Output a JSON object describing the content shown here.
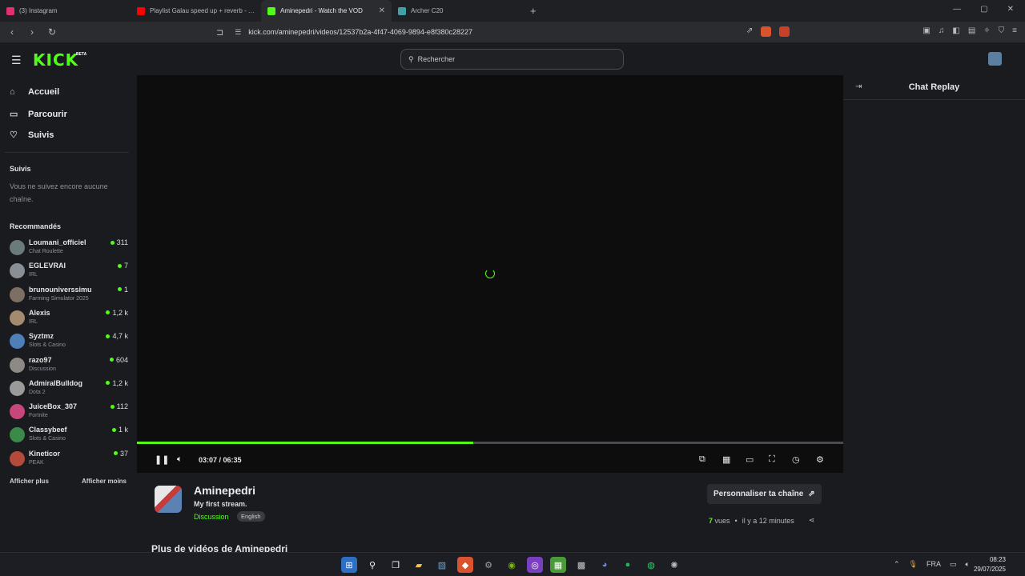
{
  "browser": {
    "tabs": [
      {
        "label": "(3) Instagram",
        "color": "#e1306c",
        "active": false
      },
      {
        "label": "Playlist Galau speed up + reverb - Yo",
        "color": "#ff0000",
        "active": false
      },
      {
        "label": "Aminepedri - Watch the VOD",
        "color": "#53fc18",
        "active": true
      },
      {
        "label": "Archer C20",
        "color": "#3fa0a8",
        "active": false
      }
    ],
    "url": "kick.com/aminepedri/videos/12537b2a-4f47-4069-9894-e8f380c28227"
  },
  "header": {
    "logo": "KICK",
    "beta": "BETA",
    "search_placeholder": "Rechercher"
  },
  "sidebar": {
    "nav": [
      {
        "label": "Accueil",
        "icon": "home-icon"
      },
      {
        "label": "Parcourir",
        "icon": "browse-icon"
      },
      {
        "label": "Suivis",
        "icon": "heart-icon"
      }
    ],
    "following_title": "Suivis",
    "following_empty": "Vous ne suivez encore aucune chaîne.",
    "recommended_title": "Recommandés",
    "recommended": [
      {
        "name": "Loumani_officiel",
        "category": "Chat Roulette",
        "viewers": "311",
        "avatar": "#6b7a7a"
      },
      {
        "name": "EGLEVRAI",
        "category": "IRL",
        "viewers": "7",
        "avatar": "#8a8f96"
      },
      {
        "name": "brunouniverssimu",
        "category": "Farming Simulator 2025",
        "viewers": "1",
        "avatar": "#7d6f64"
      },
      {
        "name": "Alexis",
        "category": "IRL",
        "viewers": "1,2 k",
        "avatar": "#a48a6f"
      },
      {
        "name": "Syztmz",
        "category": "Slots & Casino",
        "viewers": "4,7 k",
        "avatar": "#4f7fb8"
      },
      {
        "name": "razo97",
        "category": "Discussion",
        "viewers": "604",
        "avatar": "#8d8a86"
      },
      {
        "name": "AdmiralBulldog",
        "category": "Dota 2",
        "viewers": "1,2 k",
        "avatar": "#9a9a9a"
      },
      {
        "name": "JuiceBox_307",
        "category": "Fortnite",
        "viewers": "112",
        "avatar": "#c7477c"
      },
      {
        "name": "Classybeef",
        "category": "Slots & Casino",
        "viewers": "1 k",
        "avatar": "#3b8a4a"
      },
      {
        "name": "Kineticor",
        "category": "PEAK",
        "viewers": "37",
        "avatar": "#b34a3a"
      }
    ],
    "show_more": "Afficher plus",
    "show_less": "Afficher moins"
  },
  "player": {
    "progress": 0.476,
    "time": "03:07 / 06:35"
  },
  "chat": {
    "title": "Chat Replay"
  },
  "channel": {
    "name": "Aminepedri",
    "stream_title": "My first stream.",
    "category": "Discussion",
    "language": "English",
    "customize": "Personnaliser ta chaîne",
    "views_count": "7",
    "views_label": "vues",
    "time_ago": "il y a 12 minutes",
    "more_videos": "Plus de vidéos de Aminepedri"
  },
  "taskbar": {
    "language": "FRA",
    "time": "08:23",
    "date": "29/07/2025"
  },
  "colors": {
    "accent": "#53fc18",
    "background": "#191b1f"
  }
}
